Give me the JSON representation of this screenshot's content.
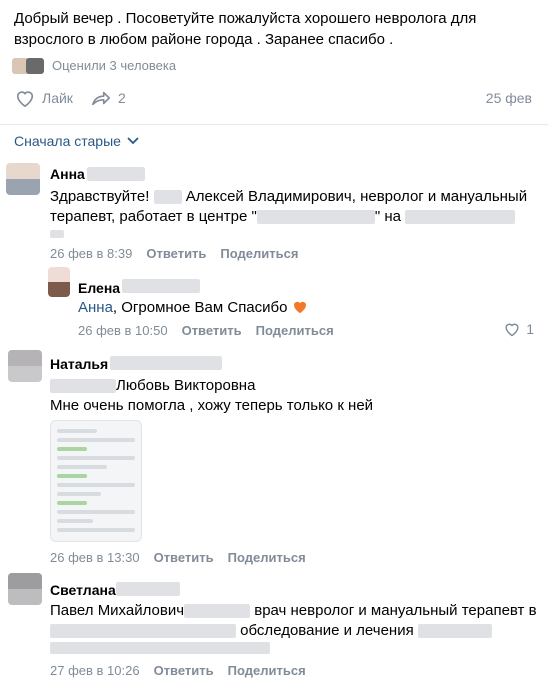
{
  "post": {
    "text": "Добрый вечер . Посоветуйте пожалуйста хорошего невролога для взрослого в любом районе города . Заранее спасибо .",
    "rated_by": "Оценили 3 человека",
    "like_label": "Лайк",
    "share_count": "2",
    "date": "25 фев"
  },
  "comments_sort": "Сначала старые",
  "comments": [
    {
      "author": "Анна",
      "text_1": "Здравствуйте!",
      "text_2": "Алексей Владимирович, невролог и мануальный",
      "text_3": "терапевт, работает в центре \"",
      "text_4": "\" на",
      "date": "26 фев в 8:39",
      "reply": "Ответить",
      "share": "Поделиться"
    },
    {
      "author": "Елена",
      "mention": "Анна",
      "text": ", Огромное Вам Спасибо",
      "date": "26 фев в 10:50",
      "reply": "Ответить",
      "share": "Поделиться",
      "likes": "1"
    },
    {
      "author": "Наталья",
      "text_1": "Любовь Викторовна",
      "text_2": "Мне очень помогла , хожу теперь только к ней",
      "date": "26 фев в 13:30",
      "reply": "Ответить",
      "share": "Поделиться"
    },
    {
      "author": "Светлана",
      "text_1": "Павел Михайлович",
      "text_2": "врач невролог и мануальный терапевт в",
      "text_3": "обследование и лечения",
      "date": "27 фев в 10:26",
      "reply": "Ответить",
      "share": "Поделиться"
    }
  ],
  "colors": {
    "link": "#2a5885",
    "secondary": "#818c99",
    "like_heart": "#f07a2a"
  }
}
